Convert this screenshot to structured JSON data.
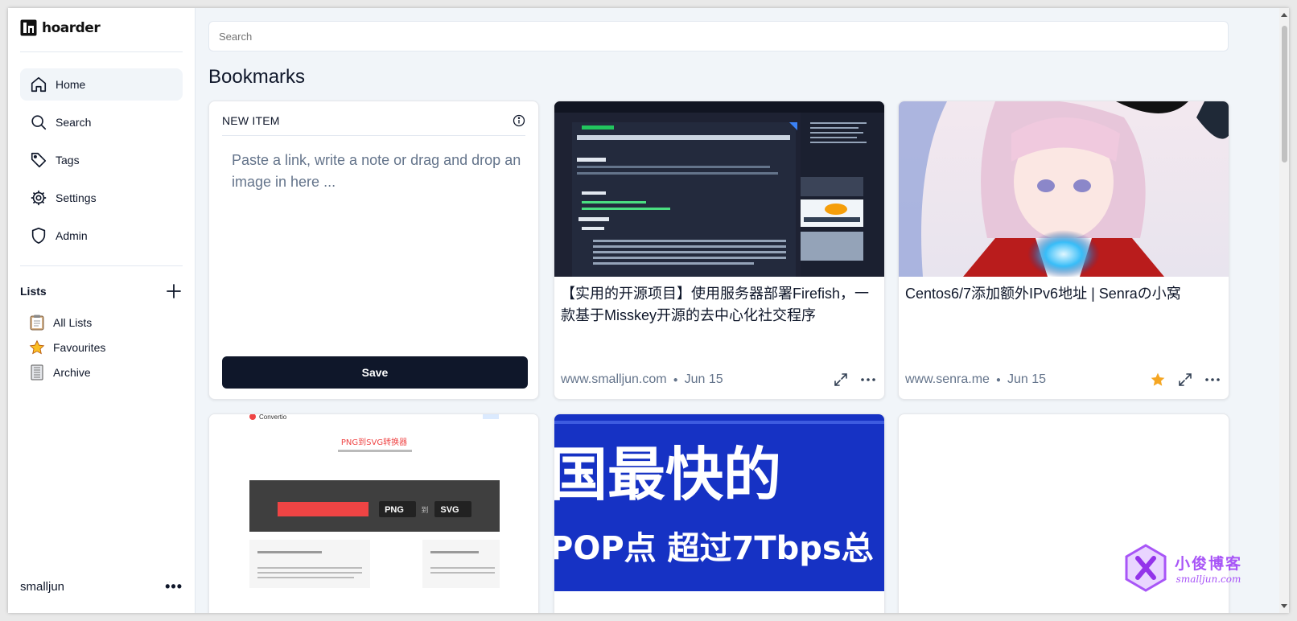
{
  "app": {
    "name": "hoarder"
  },
  "sidebar": {
    "nav": [
      {
        "label": "Home",
        "icon": "home-icon",
        "active": true
      },
      {
        "label": "Search",
        "icon": "search-icon"
      },
      {
        "label": "Tags",
        "icon": "tag-icon"
      },
      {
        "label": "Settings",
        "icon": "gear-icon"
      },
      {
        "label": "Admin",
        "icon": "shield-icon"
      }
    ],
    "lists_title": "Lists",
    "lists": [
      {
        "label": "All Lists",
        "icon": "clipboard-icon"
      },
      {
        "label": "Favourites",
        "icon": "star-icon"
      },
      {
        "label": "Archive",
        "icon": "archive-icon"
      }
    ],
    "user": "smalljun"
  },
  "search": {
    "placeholder": "Search"
  },
  "page_title": "Bookmarks",
  "new_item": {
    "title": "NEW ITEM",
    "placeholder": "Paste a link, write a note or drag and drop an image in here ...",
    "save_label": "Save"
  },
  "bookmarks": [
    {
      "title": "【实用的开源项目】使用服务器部署Firefish，一款基于Misskey开源的去中心化社交程序",
      "domain": "www.smalljun.com",
      "date": "Jun 15",
      "favourite": false
    },
    {
      "title": "Centos6/7添加额外IPv6地址 | Senraの小窝",
      "domain": "www.senra.me",
      "date": "Jun 15",
      "favourite": true
    }
  ],
  "row2_thumbs": {
    "a": {
      "brand": "Convertio",
      "heading": "PNG到SVG转换器",
      "from": "PNG",
      "to_word": "到",
      "to": "SVG"
    },
    "b": {
      "line1": "国最快的",
      "line2": "POP点  超过7Tbps总"
    }
  },
  "watermark": {
    "cn": "小俊博客",
    "en": "smalljun.com"
  },
  "colors": {
    "accent": "#0f172a",
    "star": "#f5a623",
    "muted": "#64748b"
  }
}
